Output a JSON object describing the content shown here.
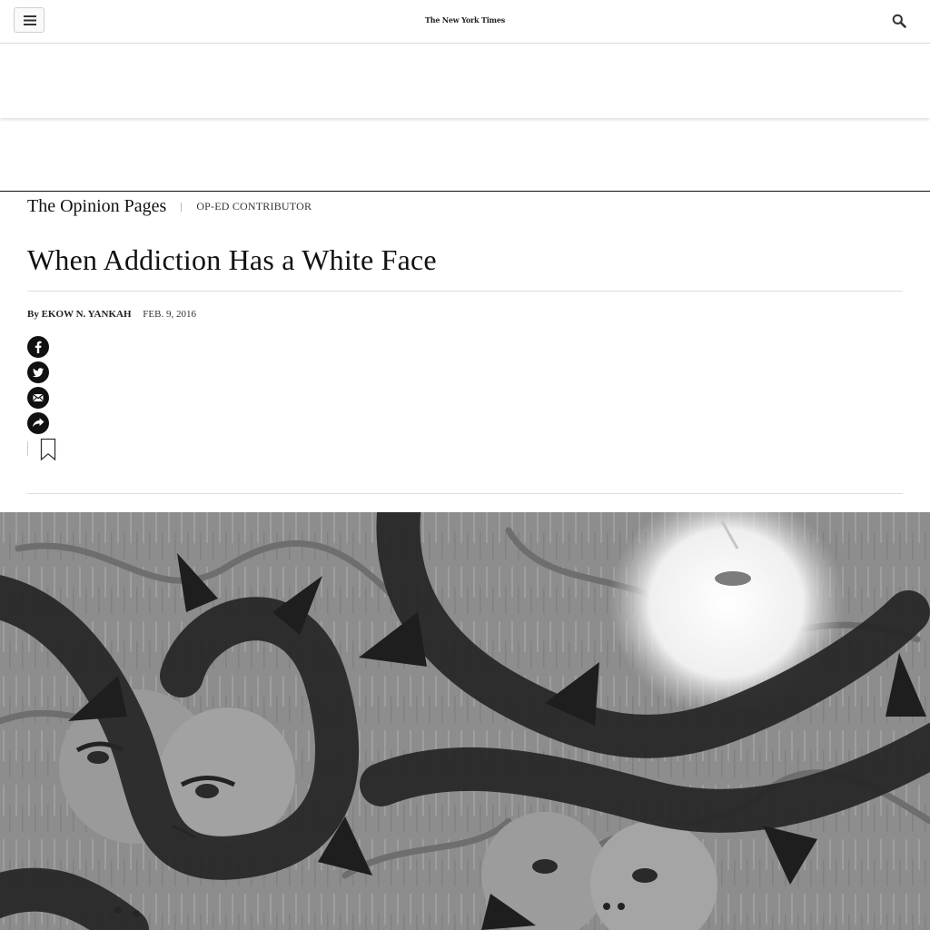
{
  "header": {
    "logo_text": "The New York Times",
    "menu_icon": "hamburger-icon",
    "search_icon": "search-icon"
  },
  "article": {
    "section": "The Opinion Pages",
    "kicker": "OP-ED CONTRIBUTOR",
    "headline": "When Addiction Has a White Face",
    "byline": "By EKOW N. YANKAH",
    "date": "FEB. 9, 2016"
  },
  "share_tools": [
    {
      "name": "facebook",
      "icon": "facebook-icon"
    },
    {
      "name": "twitter",
      "icon": "twitter-icon"
    },
    {
      "name": "email",
      "icon": "email-icon"
    },
    {
      "name": "more",
      "icon": "share-arrow-icon"
    }
  ],
  "save_icon": "bookmark-icon",
  "colors": {
    "text": "#111111",
    "rule": "#dcdcdc",
    "illustration_base": "#8d8d8d"
  }
}
